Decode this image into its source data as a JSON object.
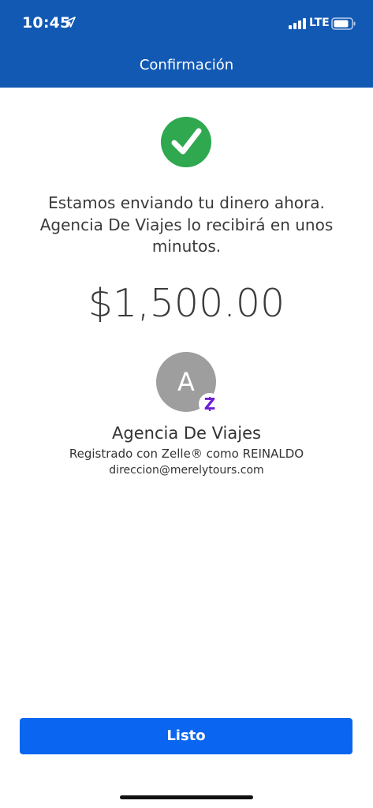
{
  "status_bar": {
    "time": "10:45",
    "network": "LTE",
    "icons": [
      "location-arrow-icon",
      "signal-icon",
      "battery-icon"
    ]
  },
  "header": {
    "title": "Confirmación",
    "background_color": "#1259b4"
  },
  "confirmation": {
    "status_icon": "check-circle-icon",
    "status_color": "#2fa84f",
    "message": "Estamos enviando tu dinero ahora.\nAgencia De Viajes  lo recibirá en unos\nminutos.",
    "amount": "$1,500.00"
  },
  "recipient": {
    "avatar_initial": "A",
    "badge_icon": "zelle-icon",
    "badge_letter": "Z",
    "badge_color": "#6d1ed4",
    "name": "Agencia De Viajes",
    "registered_text": "Registrado con Zelle® como REINALDO",
    "email": "direccion@merelytours.com"
  },
  "actions": {
    "done_label": "Listo",
    "button_color": "#0a66f0"
  }
}
